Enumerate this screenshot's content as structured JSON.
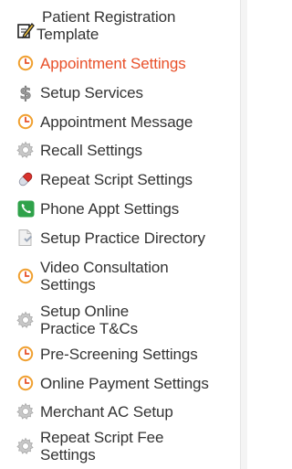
{
  "sidebar": {
    "active_color": "#e8502a",
    "text_color": "#333333",
    "items": [
      {
        "label_line1": "Patient Registration",
        "label_line2": "Template",
        "icon": "edit-icon"
      },
      {
        "label": "Appointment Settings",
        "icon": "clock-icon",
        "active": true
      },
      {
        "label": "Setup Services",
        "icon": "dollar-icon"
      },
      {
        "label": "Appointment Message",
        "icon": "clock-icon"
      },
      {
        "label": "Recall Settings",
        "icon": "gear-icon"
      },
      {
        "label": "Repeat Script Settings",
        "icon": "pill-icon"
      },
      {
        "label": "Phone Appt Settings",
        "icon": "phone-icon"
      },
      {
        "label": "Setup Practice Directory",
        "icon": "directory-icon"
      },
      {
        "label_line1": "Video Consultation",
        "label_line2": "Settings",
        "icon": "clock-icon"
      },
      {
        "label_line1": "Setup Online",
        "label_line2": "Practice T&Cs",
        "icon": "gear-icon"
      },
      {
        "label": "Pre-Screening Settings",
        "icon": "clock-icon"
      },
      {
        "label": "Online Payment Settings",
        "icon": "clock-icon"
      },
      {
        "label": "Merchant AC Setup",
        "icon": "gear-icon"
      },
      {
        "label_line1": "Repeat Script Fee",
        "label_line2": "Settings",
        "icon": "gear-icon"
      }
    ]
  }
}
